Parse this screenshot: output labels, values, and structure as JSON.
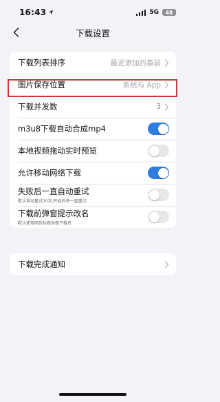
{
  "status_bar": {
    "time": "16:43",
    "network": "5G",
    "battery": "48"
  },
  "nav": {
    "title": "下载设置"
  },
  "settings": [
    {
      "label": "下载列表排序",
      "value": "最近添加的靠前"
    },
    {
      "label": "图片保存位置",
      "value": "系统与 App"
    },
    {
      "label": "下载并发数",
      "value": "3"
    },
    {
      "label": "m3u8下载自动合成mp4",
      "toggle": true
    },
    {
      "label": "本地视频拖动实时预览",
      "toggle": false
    },
    {
      "label": "允许移动网络下载",
      "toggle": true
    },
    {
      "label": "失败后一直自动重试",
      "sublabel": "默认自动重试30次,开启后将一直重试",
      "toggle": false
    },
    {
      "label": "下载前弹窗提示改名",
      "sublabel": "默认使用网页标题当做下载名",
      "toggle": false
    }
  ],
  "notifications": {
    "label": "下载完成通知"
  },
  "icons": {
    "back": "chevron-left-icon",
    "row": "chevron-right-icon",
    "location": "location-arrow-icon"
  },
  "colors": {
    "accent": "#2f7de1",
    "highlight": "#c83a3e",
    "background": "#f2f2f7"
  }
}
